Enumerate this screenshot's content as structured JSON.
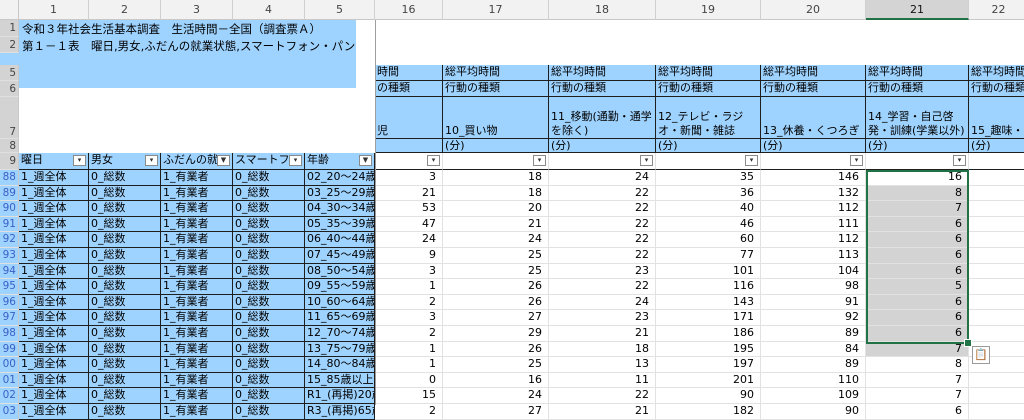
{
  "col_headers": [
    "1",
    "2",
    "3",
    "4",
    "5",
    "16",
    "17",
    "18",
    "19",
    "20",
    "21",
    "22"
  ],
  "selected_col": "21",
  "row_headers_top": [
    "1",
    "2",
    "5",
    "6",
    "7",
    "8",
    "9"
  ],
  "titles": {
    "r1": "令和３年社会生活基本調査　生活時間－全国（調査票Ａ）",
    "r2": "第１－１表　曜日,男女,ふだんの就業状態,スマートフォン・パン"
  },
  "row5_header": "総平均時間",
  "row5_partial_left": "時間",
  "row6_header": "行動の種類",
  "row6_partial_left": "の種類",
  "row7_partial_left": "児",
  "row7_items": {
    "c17": "10_買い物",
    "c18": "11_移動(通勤・通学を除く)",
    "c19": "12_テレビ・ラジオ・新聞・雑誌",
    "c20": "13_休養・くつろぎ",
    "c21": "14_学習・自己啓発・訓練(学業以外)",
    "c22": "15_趣味・"
  },
  "unit_label": "(分)",
  "filter_headers": [
    "曜日",
    "男女",
    "ふだんの就",
    "スマートフ",
    "年齢"
  ],
  "data_row_headers": [
    "88",
    "89",
    "90",
    "91",
    "92",
    "93",
    "94",
    "95",
    "96",
    "97",
    "98",
    "99",
    "00",
    "01",
    "02",
    "03"
  ],
  "data_rows": [
    {
      "c1": "1_週全体",
      "c2": "0_総数",
      "c3": "1_有業者",
      "c4": "0_総数",
      "c5": "02_20～24歳",
      "v": [
        3,
        18,
        24,
        35,
        146,
        16
      ]
    },
    {
      "c1": "1_週全体",
      "c2": "0_総数",
      "c3": "1_有業者",
      "c4": "0_総数",
      "c5": "03_25～29歳",
      "v": [
        21,
        18,
        22,
        36,
        132,
        8
      ]
    },
    {
      "c1": "1_週全体",
      "c2": "0_総数",
      "c3": "1_有業者",
      "c4": "0_総数",
      "c5": "04_30～34歳",
      "v": [
        53,
        20,
        22,
        40,
        112,
        7
      ]
    },
    {
      "c1": "1_週全体",
      "c2": "0_総数",
      "c3": "1_有業者",
      "c4": "0_総数",
      "c5": "05_35～39歳",
      "v": [
        47,
        21,
        22,
        46,
        111,
        6
      ]
    },
    {
      "c1": "1_週全体",
      "c2": "0_総数",
      "c3": "1_有業者",
      "c4": "0_総数",
      "c5": "06_40～44歳",
      "v": [
        24,
        24,
        22,
        60,
        112,
        6
      ]
    },
    {
      "c1": "1_週全体",
      "c2": "0_総数",
      "c3": "1_有業者",
      "c4": "0_総数",
      "c5": "07_45～49歳",
      "v": [
        9,
        25,
        22,
        77,
        113,
        6
      ]
    },
    {
      "c1": "1_週全体",
      "c2": "0_総数",
      "c3": "1_有業者",
      "c4": "0_総数",
      "c5": "08_50～54歳",
      "v": [
        3,
        25,
        23,
        101,
        104,
        6
      ]
    },
    {
      "c1": "1_週全体",
      "c2": "0_総数",
      "c3": "1_有業者",
      "c4": "0_総数",
      "c5": "09_55～59歳",
      "v": [
        1,
        26,
        22,
        116,
        98,
        5
      ]
    },
    {
      "c1": "1_週全体",
      "c2": "0_総数",
      "c3": "1_有業者",
      "c4": "0_総数",
      "c5": "10_60～64歳",
      "v": [
        2,
        26,
        24,
        143,
        91,
        6
      ]
    },
    {
      "c1": "1_週全体",
      "c2": "0_総数",
      "c3": "1_有業者",
      "c4": "0_総数",
      "c5": "11_65～69歳",
      "v": [
        3,
        27,
        23,
        171,
        92,
        6
      ]
    },
    {
      "c1": "1_週全体",
      "c2": "0_総数",
      "c3": "1_有業者",
      "c4": "0_総数",
      "c5": "12_70～74歳",
      "v": [
        2,
        29,
        21,
        186,
        89,
        6
      ]
    },
    {
      "c1": "1_週全体",
      "c2": "0_総数",
      "c3": "1_有業者",
      "c4": "0_総数",
      "c5": "13_75～79歳",
      "v": [
        1,
        26,
        18,
        195,
        84,
        7
      ]
    },
    {
      "c1": "1_週全体",
      "c2": "0_総数",
      "c3": "1_有業者",
      "c4": "0_総数",
      "c5": "14_80～84歳",
      "v": [
        1,
        25,
        13,
        197,
        89,
        8
      ]
    },
    {
      "c1": "1_週全体",
      "c2": "0_総数",
      "c3": "1_有業者",
      "c4": "0_総数",
      "c5": "15_85歳以上",
      "v": [
        0,
        16,
        11,
        201,
        110,
        7
      ]
    },
    {
      "c1": "1_週全体",
      "c2": "0_総数",
      "c3": "1_有業者",
      "c4": "0_総数",
      "c5": "R1_(再掲)20歳",
      "v": [
        15,
        24,
        22,
        90,
        109,
        7
      ]
    },
    {
      "c1": "1_週全体",
      "c2": "0_総数",
      "c3": "1_有業者",
      "c4": "0_総数",
      "c5": "R3_(再掲)65歳",
      "v": [
        2,
        27,
        21,
        182,
        90,
        6
      ]
    }
  ],
  "highlight_rows_col21": [
    1,
    11
  ],
  "icons": {
    "filter": "filter-dropdown-icon",
    "filter_active": "filter-active-icon",
    "paste": "paste-options-icon"
  }
}
